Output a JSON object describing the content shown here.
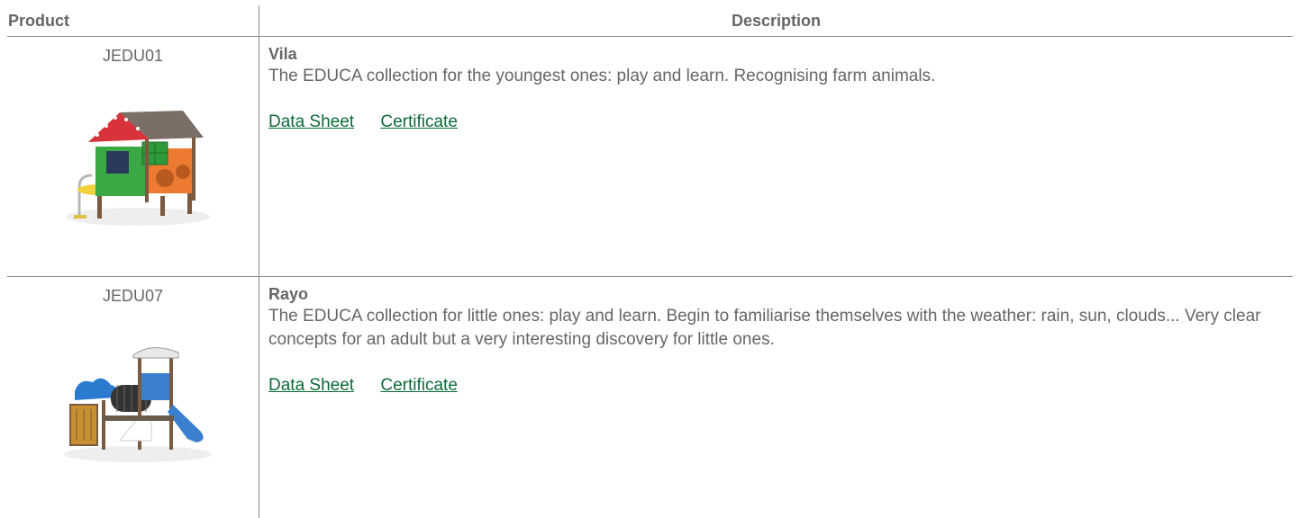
{
  "table": {
    "headers": {
      "product": "Product",
      "description": "Description"
    },
    "rows": [
      {
        "code": "JEDU01",
        "name": "Vila",
        "description": "The EDUCA collection for the youngest ones: play and learn. Recognising farm animals.",
        "links": {
          "data_sheet": "Data Sheet",
          "certificate": "Certificate"
        }
      },
      {
        "code": "JEDU07",
        "name": "Rayo",
        "description": "The EDUCA collection for little ones: play and learn. Begin to familiarise themselves with the weather: rain, sun, clouds... Very clear concepts for an adult but a very interesting discovery for little ones.",
        "links": {
          "data_sheet": "Data Sheet",
          "certificate": "Certificate"
        }
      }
    ]
  },
  "colors": {
    "text": "#666666",
    "link": "#0a6b3a",
    "border": "#8a8a8a"
  },
  "icons": {
    "row1_image": "playhouse-image",
    "row2_image": "playground-tower-image"
  }
}
